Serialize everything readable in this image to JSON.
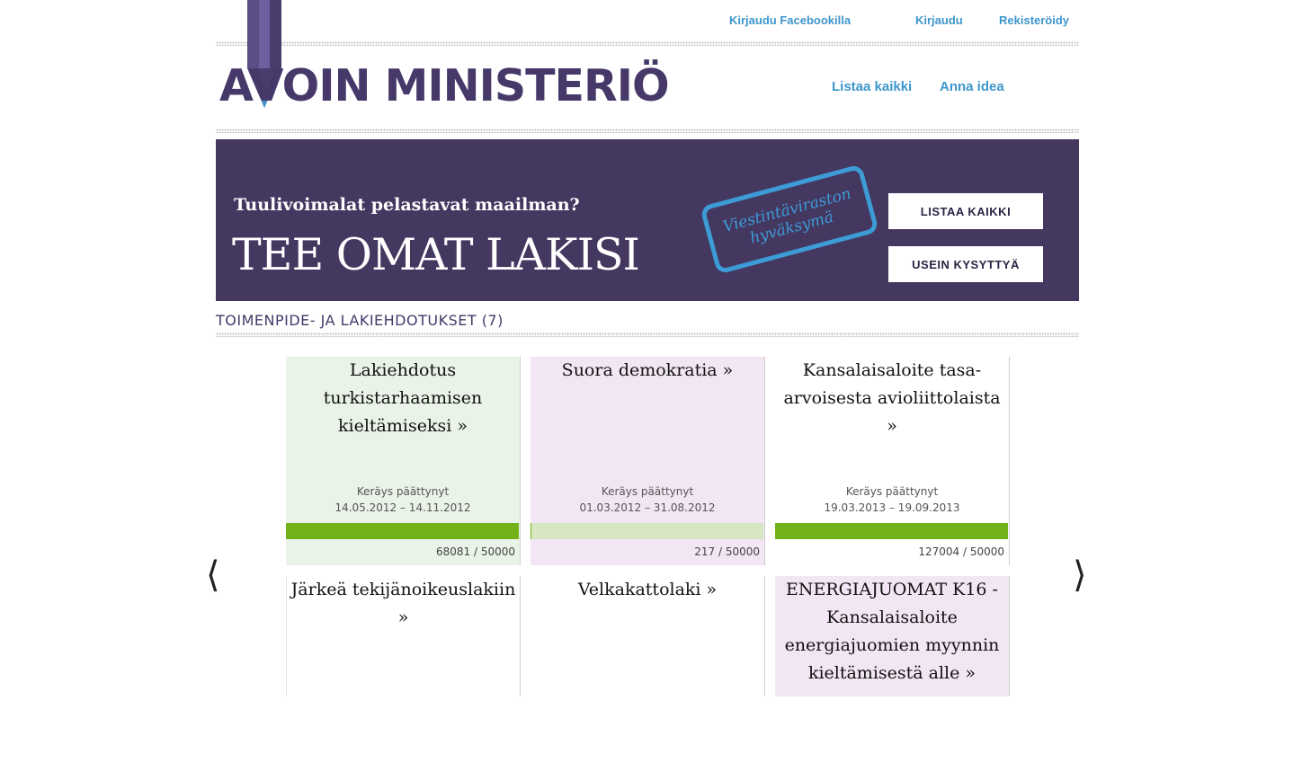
{
  "header": {
    "top_links": [
      "Kirjaudu Facebookilla",
      "Kirjaudu",
      "Rekisteröidy"
    ],
    "logo_text": "AVOIN MINISTERIÖ",
    "nav": [
      "Listaa kaikki",
      "Anna idea"
    ]
  },
  "hero": {
    "subtitle": "Tuulivoimalat pelastavat maailman?",
    "title": "TEE OMAT LAKISI",
    "stamp_text": "Viestintäviraston hyväksymä",
    "buttons": [
      "LISTAA KAIKKI",
      "USEIN KYSYTTYÄ"
    ]
  },
  "section": {
    "title": "TOIMENPIDE- JA LAKIEHDOTUKSET (7)"
  },
  "carousel": {
    "prev_glyph": "⟨",
    "next_glyph": "⟩"
  },
  "cards": [
    {
      "title": "Lakiehdotus turkistarhaamisen kieltämiseksi »",
      "status": "Keräys päättynyt",
      "dates": "14.05.2012 – 14.11.2012",
      "count": "68081 / 50000",
      "progress": 1.0,
      "bg": "#eaf3e8"
    },
    {
      "title": "Suora demokratia »",
      "status": "Keräys päättynyt",
      "dates": "01.03.2012 – 31.08.2012",
      "count": "217 / 50000",
      "progress": 0.0043,
      "bg": "#f3e6f4"
    },
    {
      "title": "Kansalaisaloite tasa-arvoisesta avioliittolaista »",
      "status": "Keräys päättynyt",
      "dates": "19.03.2013 – 19.09.2013",
      "count": "127004 / 50000",
      "progress": 1.0,
      "bg": "#ffffff"
    },
    {
      "title": "Järkeä tekijänoikeuslakiin »",
      "bg": "#ffffff"
    },
    {
      "title": "Velkakattolaki »",
      "bg": "#ffffff"
    },
    {
      "title": "ENERGIAJUOMAT K16 - Kansalaisaloite energiajuomien myynnin kieltämisestä alle »",
      "bg": "#f3e6f4"
    }
  ],
  "colors": {
    "brand_purple": "#46396a",
    "hero_bg": "#443860",
    "link_blue": "#3d96cd",
    "progress_green": "#72b218",
    "progress_track": "#d8e7c3"
  }
}
